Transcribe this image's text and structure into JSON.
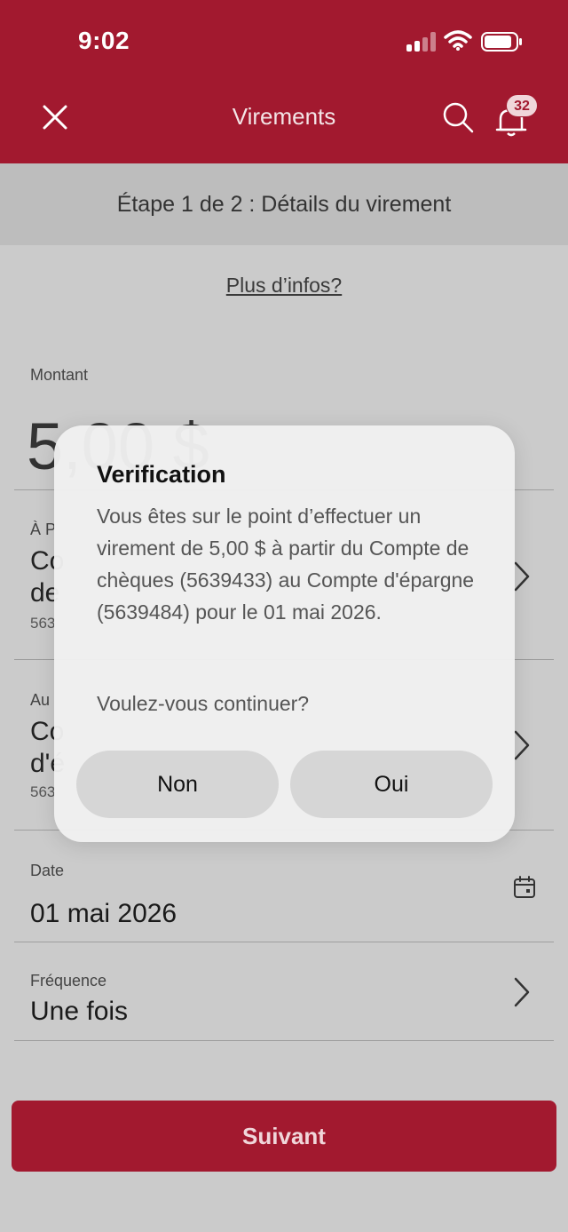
{
  "status": {
    "time": "9:02"
  },
  "header": {
    "title": "Virements",
    "notification_count": "32"
  },
  "step": {
    "label": "Étape 1 de 2 : Détails du virement"
  },
  "more_info": "Plus d’infos?",
  "amount": {
    "label": "Montant",
    "value": "5,00 $"
  },
  "from_account": {
    "label": "À P",
    "title_line1": "Co",
    "title_line2": "de",
    "number": "563"
  },
  "to_account": {
    "label": "Au",
    "title_line1": "Co",
    "title_line2": "d'é",
    "number": "563"
  },
  "date": {
    "label": "Date",
    "value": "01 mai 2026"
  },
  "frequency": {
    "label": "Fréquence",
    "value": "Une fois"
  },
  "next_button": "Suivant",
  "dialog": {
    "title": "Verification",
    "message": "Vous êtes sur le point d’effectuer un virement de 5,00 $ à partir du Compte de chèques (5639433) au Compte d'épargne (5639484) pour le 01 mai 2026.",
    "question": "Voulez-vous continuer?",
    "no_label": "Non",
    "yes_label": "Oui"
  },
  "colors": {
    "brand": "#a2192f",
    "overlay": "#cbcbcb",
    "dialog": "#f0f0f0"
  }
}
